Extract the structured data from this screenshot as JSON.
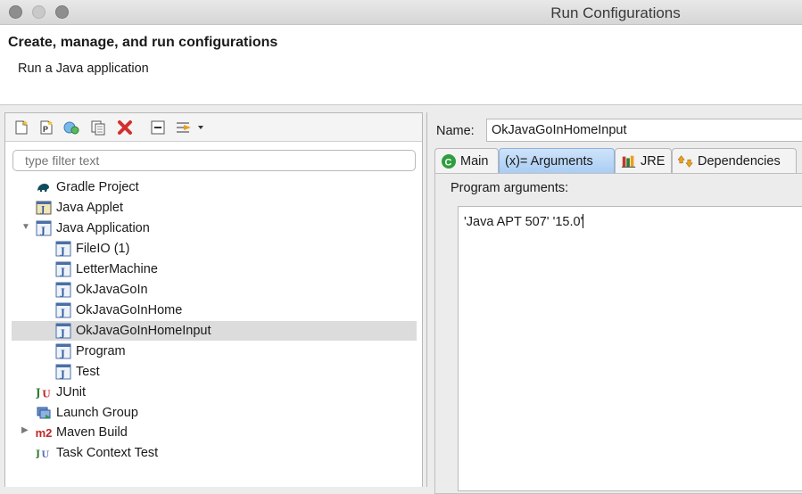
{
  "window": {
    "title": "Run Configurations"
  },
  "header": {
    "title": "Create, manage, and run configurations",
    "subtitle": "Run a Java application"
  },
  "toolbar": {
    "buttons": [
      "new-config-icon",
      "new-prototype-icon",
      "export-icon",
      "duplicate-icon",
      "delete-icon",
      "collapse-all-icon",
      "filter-icon"
    ]
  },
  "filter": {
    "placeholder": "type filter text"
  },
  "tree": {
    "items": [
      {
        "label": "Gradle Project",
        "icon": "gradle-icon"
      },
      {
        "label": "Java Applet",
        "icon": "applet-icon"
      },
      {
        "label": "Java Application",
        "icon": "java-app-icon",
        "expanded": true
      },
      {
        "label": "FileIO (1)",
        "icon": "java-class-icon"
      },
      {
        "label": "LetterMachine",
        "icon": "java-class-icon"
      },
      {
        "label": "OkJavaGoIn",
        "icon": "java-class-icon"
      },
      {
        "label": "OkJavaGoInHome",
        "icon": "java-class-icon"
      },
      {
        "label": "OkJavaGoInHomeInput",
        "icon": "java-class-icon",
        "selected": true
      },
      {
        "label": "Program",
        "icon": "java-class-icon"
      },
      {
        "label": "Test",
        "icon": "java-class-icon"
      },
      {
        "label": "JUnit",
        "icon": "junit-icon"
      },
      {
        "label": "Launch Group",
        "icon": "launch-group-icon"
      },
      {
        "label": "Maven Build",
        "icon": "maven-icon",
        "expanded": false
      },
      {
        "label": "Task Context Test",
        "icon": "task-context-icon"
      }
    ]
  },
  "config": {
    "name_label": "Name:",
    "name_value": "OkJavaGoInHomeInput",
    "tabs": [
      {
        "label": "Main",
        "icon": "main-tab-icon"
      },
      {
        "label": "(x)= Arguments",
        "icon": "",
        "active": true
      },
      {
        "label": "JRE",
        "icon": "jre-icon"
      },
      {
        "label": "Dependencies",
        "icon": "dependencies-icon"
      }
    ],
    "program_args_label": "Program arguments:",
    "program_args_value": "'Java APT 507' '15.0'"
  },
  "colors": {
    "selection": "#dcdcdc",
    "active_tab": "#a9cdf4",
    "delete": "#d32f2f"
  }
}
